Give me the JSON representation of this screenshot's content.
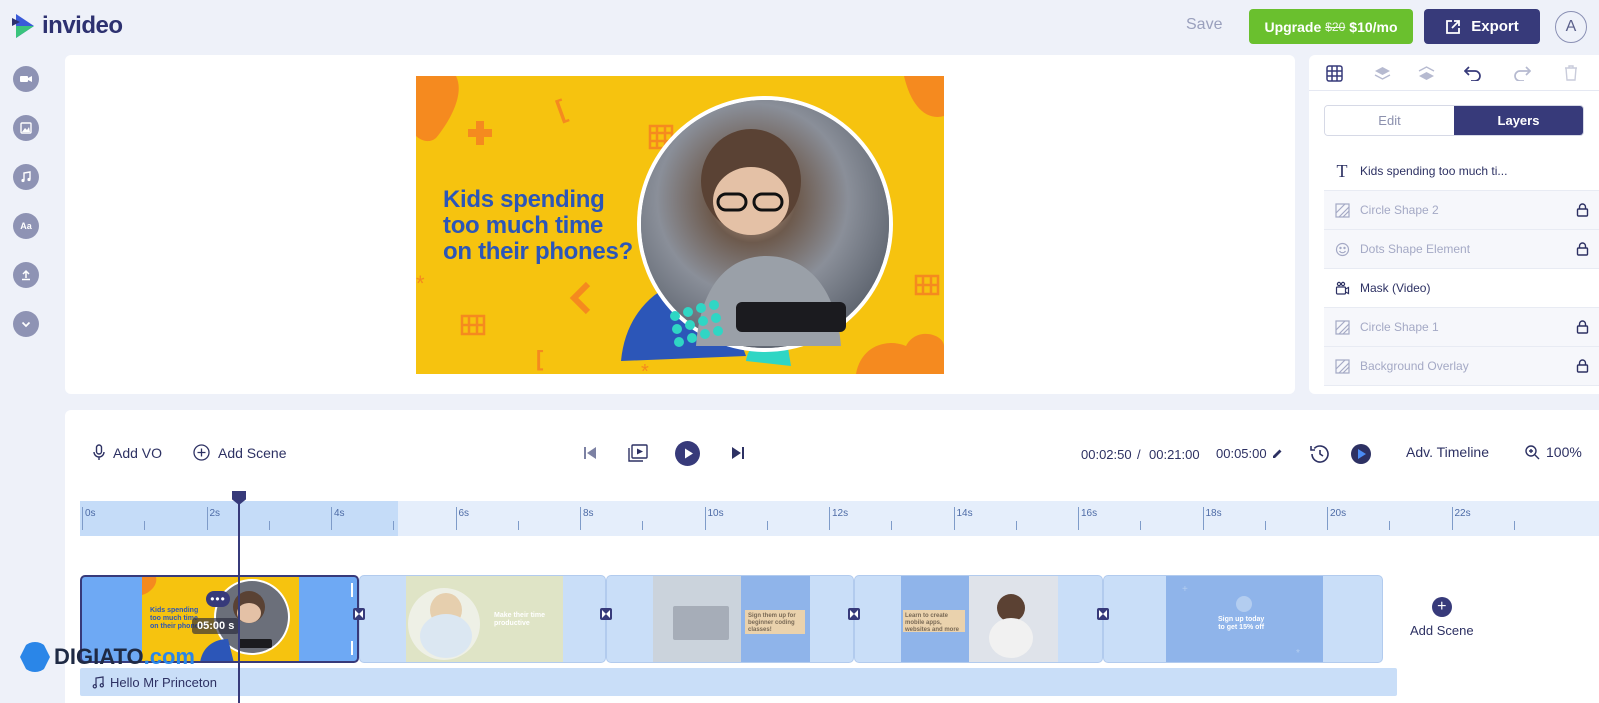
{
  "header": {
    "brand": "invideo",
    "save_label": "Save",
    "upgrade_label": "Upgrade",
    "upgrade_old_price": "$20",
    "upgrade_price": "$10/mo",
    "export_label": "Export",
    "avatar_initial": "A"
  },
  "sidebar": {
    "items": [
      {
        "icon": "video-camera-icon"
      },
      {
        "icon": "image-icon"
      },
      {
        "icon": "music-note-icon"
      },
      {
        "icon": "text-icon",
        "label": "Aa"
      },
      {
        "icon": "upload-icon"
      },
      {
        "icon": "chevron-down-icon"
      }
    ]
  },
  "canvas": {
    "title": "Kids spending\ntoo much time\non their phones?"
  },
  "right_panel": {
    "tabs": {
      "edit": "Edit",
      "layers": "Layers"
    },
    "layers": [
      {
        "name": "Kids spending too much ti...",
        "icon": "text-icon",
        "locked": false,
        "dim": false
      },
      {
        "name": "Circle Shape 2",
        "icon": "shape-icon",
        "locked": true,
        "dim": true
      },
      {
        "name": "Dots Shape Element",
        "icon": "sticker-icon",
        "locked": true,
        "dim": true
      },
      {
        "name": "Mask (Video)",
        "icon": "video-mask-icon",
        "locked": false,
        "dim": false
      },
      {
        "name": "Circle Shape 1",
        "icon": "shape-icon",
        "locked": true,
        "dim": true
      },
      {
        "name": "Background Overlay",
        "icon": "shape-icon",
        "locked": true,
        "dim": true
      }
    ]
  },
  "timeline": {
    "add_vo": "Add VO",
    "add_scene": "Add Scene",
    "current_time": "00:02:50",
    "total_time": "00:21:00",
    "scene_duration": "00:05:00",
    "adv_timeline": "Adv. Timeline",
    "zoom": "100%",
    "ruler_labels": [
      "0s",
      "2s",
      "4s",
      "6s",
      "8s",
      "10s",
      "12s",
      "14s",
      "16s",
      "18s",
      "20s",
      "22s"
    ],
    "active_scene_duration": "05:00 s",
    "scenes": [
      {
        "text": "Kids spending\ntoo much time\non their phones?"
      },
      {
        "text": "Make their time\nproductive"
      },
      {
        "text": "Sign them up for\nbeginner coding\nclasses!"
      },
      {
        "text": "Learn to create\nmobile apps,\nwebsites and more"
      },
      {
        "text": "Sign up today\nto get 15% off"
      }
    ],
    "add_scene_label": "Add Scene",
    "audio_track": "Hello Mr Princeton"
  },
  "watermark": {
    "name": "DIGIATO",
    "suffix": ".com"
  }
}
